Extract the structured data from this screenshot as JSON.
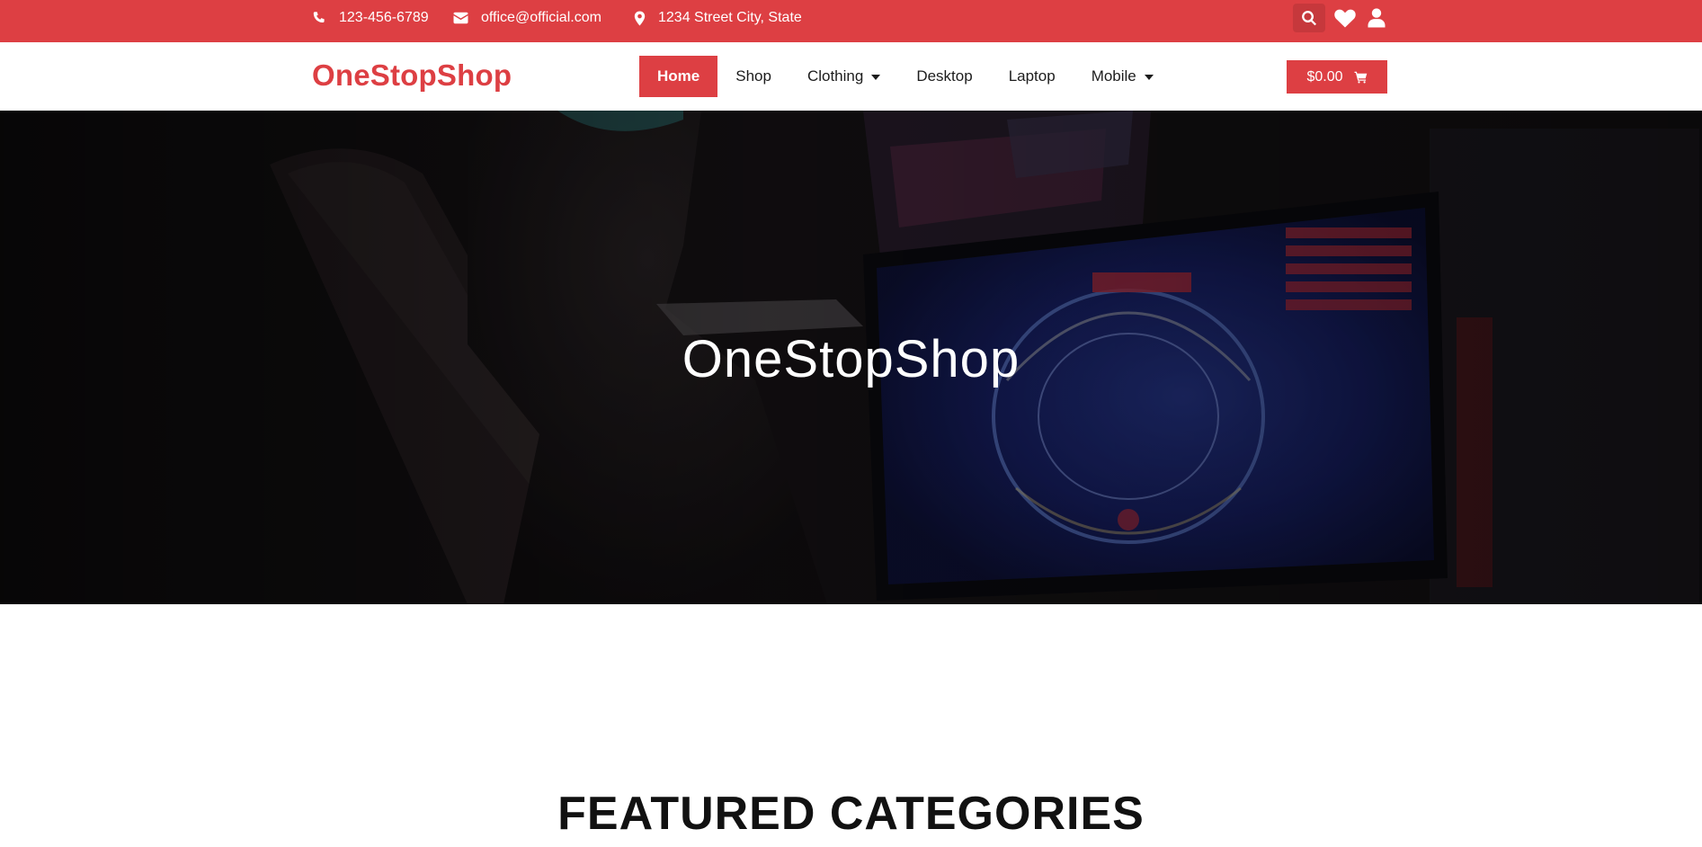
{
  "topbar": {
    "phone": "123-456-6789",
    "email": "office@official.com",
    "address": "1234 Street City, State",
    "icons": [
      "phone-icon",
      "envelope-icon",
      "map-marker-icon",
      "search-icon",
      "heart-icon",
      "user-icon"
    ]
  },
  "header": {
    "logo": "OneStopShop",
    "nav": [
      {
        "label": "Home",
        "active": true
      },
      {
        "label": "Shop"
      },
      {
        "label": "Clothing",
        "dropdown": true
      },
      {
        "label": "Desktop"
      },
      {
        "label": "Laptop"
      },
      {
        "label": "Mobile",
        "dropdown": true
      }
    ],
    "cart_total": "$0.00"
  },
  "hero": {
    "title": "OneStopShop"
  },
  "featured": {
    "title": "FEATURED CATEGORIES"
  },
  "colors": {
    "accent": "#dd3f43",
    "text": "#1c1c1c",
    "hero_overlay": "#141214"
  }
}
